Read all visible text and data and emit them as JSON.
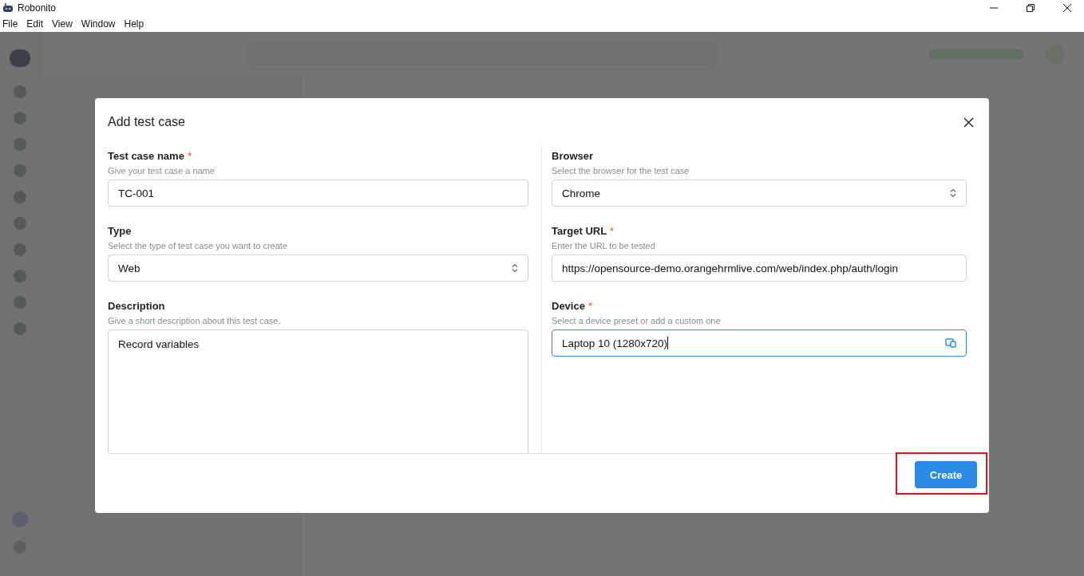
{
  "window": {
    "title": "Robonito"
  },
  "menu": [
    "File",
    "Edit",
    "View",
    "Window",
    "Help"
  ],
  "dialog": {
    "title": "Add test case",
    "columns": [
      [
        {
          "kind": "text",
          "label": "Test case name",
          "required_mark": "*",
          "hint": "Give your test case a name",
          "value": "TC-001"
        },
        {
          "kind": "select",
          "label": "Type",
          "hint": "Select the type of test case you want to create",
          "value": "Web"
        },
        {
          "kind": "textarea",
          "label": "Description",
          "hint": "Give a short description about this test case.",
          "value": "Record variables"
        }
      ],
      [
        {
          "kind": "select",
          "label": "Browser",
          "hint": "Select the browser for the test case",
          "value": "Chrome"
        },
        {
          "kind": "text",
          "label": "Target URL",
          "required_mark": "*",
          "hint": "Enter the URL to be tested",
          "value": "https://opensource-demo.orangehrmlive.com/web/index.php/auth/login"
        },
        {
          "kind": "device",
          "label": "Device",
          "required_mark": "*",
          "hint": "Select a device preset or add a custom one",
          "value": "Laptop 10 (1280x720)",
          "focused": true
        }
      ]
    ],
    "create_button": {
      "label": "Create",
      "highlighted": true
    }
  }
}
